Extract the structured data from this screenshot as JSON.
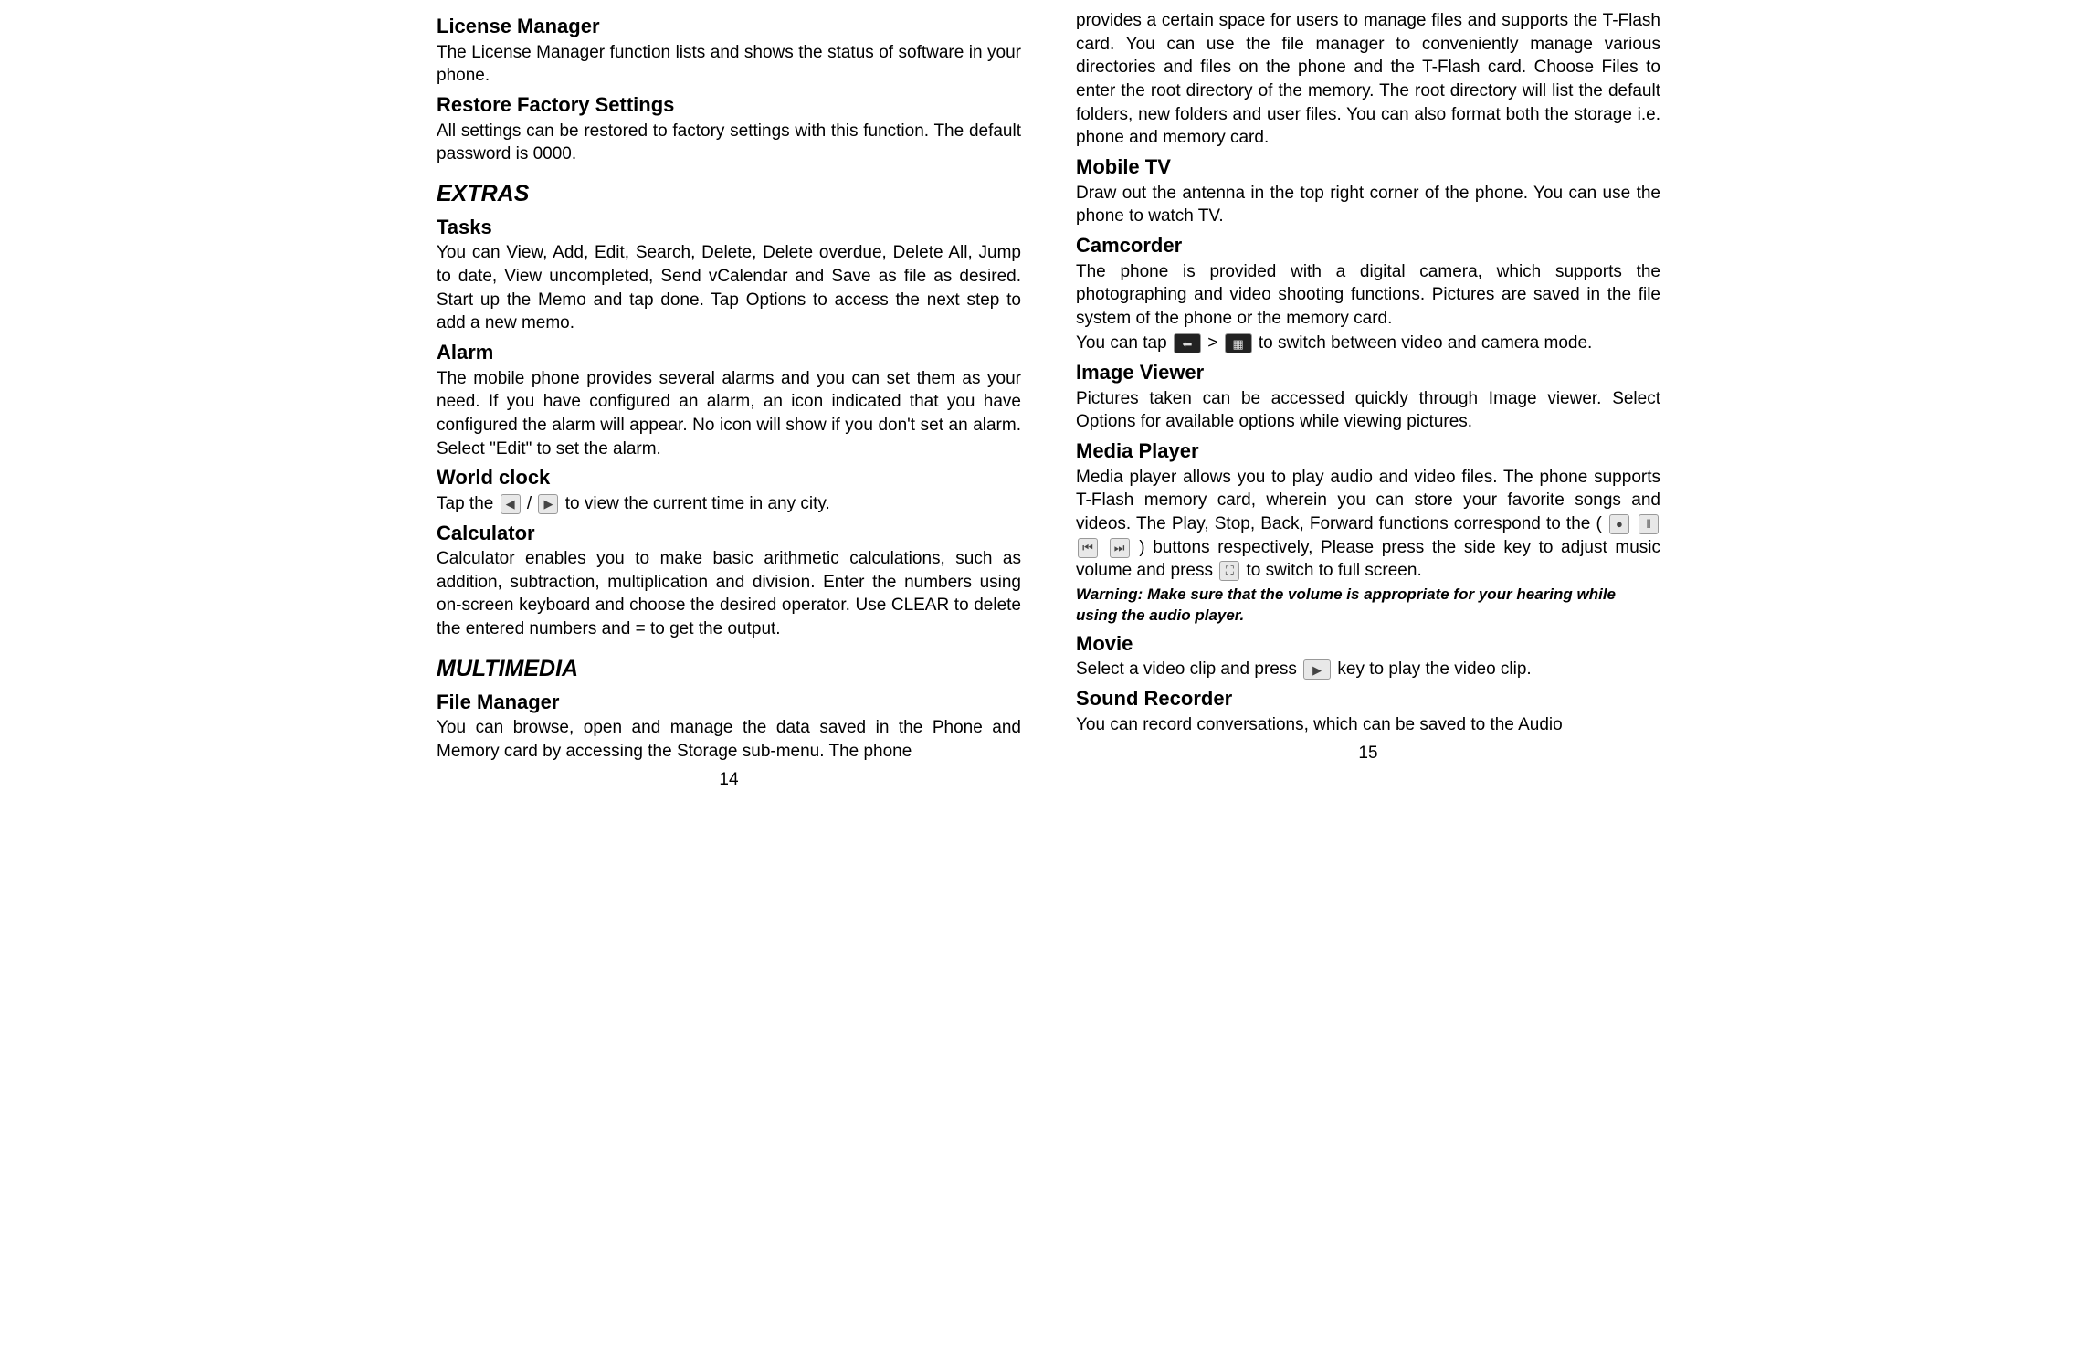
{
  "left": {
    "licenseManager": {
      "heading": "License Manager",
      "text": "The License Manager function lists and shows the status of software in your phone."
    },
    "restoreFactory": {
      "heading": "Restore Factory Settings",
      "text": "All settings can be restored to factory settings with this function. The default password is 0000."
    },
    "extras": {
      "heading": "EXTRAS",
      "tasks": {
        "heading": "Tasks",
        "text": "You can View, Add, Edit, Search, Delete, Delete overdue, Delete All, Jump to date, View uncompleted, Send vCalendar and Save as file as desired. Start up the Memo and tap done. Tap Options to access the next step to add a new memo."
      },
      "alarm": {
        "heading": "Alarm",
        "text": "The mobile phone provides several alarms and you can set them as your need. If you have configured an alarm, an icon indicated that you have configured the alarm will appear. No icon will show if you don't set an alarm. Select \"Edit\" to set the alarm."
      },
      "worldClock": {
        "heading": "World clock",
        "pre": "Tap the ",
        "mid": " / ",
        "post": " to view the current time in any city."
      },
      "calculator": {
        "heading": "Calculator",
        "text": "Calculator enables you to make basic arithmetic calculations, such as addition, subtraction, multiplication and division. Enter the numbers using on-screen keyboard and choose the desired operator. Use CLEAR to delete the entered numbers and = to get the output."
      }
    },
    "multimedia": {
      "heading": "MULTIMEDIA",
      "fileManager": {
        "heading": "File Manager",
        "text": "You can browse, open and manage the data saved in the Phone and Memory card by accessing the Storage sub-menu. The phone"
      }
    },
    "pageNum": "14"
  },
  "right": {
    "fileManagerCont": "provides a certain space for users to manage files and supports the T-Flash card. You can use the file manager to conveniently manage various directories and files on the phone and the T-Flash card. Choose Files to enter the root directory of the memory. The root directory will list the default folders, new folders and user files. You can also format both the storage i.e. phone and memory card.",
    "mobileTV": {
      "heading": "Mobile TV",
      "text": "Draw out the antenna in the top right corner of the phone. You can use the phone to watch TV."
    },
    "camcorder": {
      "heading": "Camcorder",
      "text1": "The phone is provided with a digital camera, which supports the photographing and video shooting functions. Pictures are saved in the file system of the phone or the memory card.",
      "pre": "You can tap ",
      "mid": " > ",
      "post": " to switch between video and camera mode."
    },
    "imageViewer": {
      "heading": "Image Viewer",
      "text": "Pictures taken can be accessed quickly through Image viewer. Select Options for available options while viewing pictures."
    },
    "mediaPlayer": {
      "heading": "Media Player",
      "pre": "Media player allows you to play audio and video files. The phone supports T-Flash memory card, wherein you can store your favorite songs and videos. The Play, Stop, Back, Forward functions correspond to the (",
      "mid": ") buttons respectively, Please press the side key to adjust music volume and press ",
      "post": " to switch to full screen.",
      "warning": "Warning: Make sure that the volume is appropriate for your hearing while using the audio player."
    },
    "movie": {
      "heading": "Movie",
      "pre": "Select a video clip and press ",
      "post": " key to play the video clip."
    },
    "soundRecorder": {
      "heading": "Sound Recorder",
      "text": "You can record conversations, which can be saved to the Audio"
    },
    "pageNum": "15"
  },
  "icons": {
    "leftArrow": "◀",
    "rightArrow": "▶",
    "camera": "⬅",
    "grid": "▦",
    "play": "●",
    "pause": "‖",
    "back": "⏮",
    "forward": "⏭",
    "fullscreen": "⛶",
    "playTri": "▶"
  }
}
